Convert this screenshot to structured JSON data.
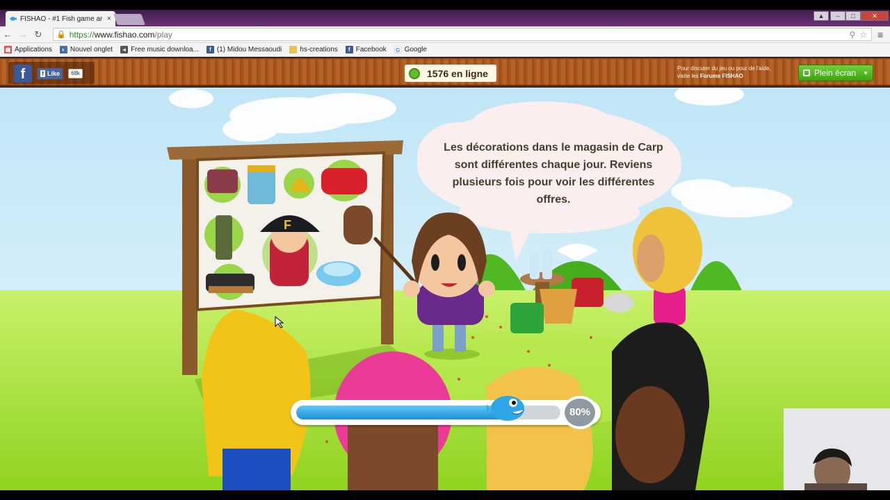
{
  "browser": {
    "tab_title": "FISHAO - #1 Fish game ar",
    "tab_close": "×",
    "url_scheme": "https://",
    "url_host": "www.fishao.com",
    "url_path": "/play",
    "bookmarks": [
      {
        "label": "Applications",
        "icon": "apps-grid-icon",
        "color": "#d9534f"
      },
      {
        "label": "Nouvel onglet",
        "icon": "new-tab-icon",
        "color": "#4a6da7"
      },
      {
        "label": "Free music downloa...",
        "icon": "speaker-icon",
        "color": "#555555"
      },
      {
        "label": "(1) Midou Messaoudi",
        "icon": "facebook-icon",
        "color": "#3b5998"
      },
      {
        "label": "hs-creations",
        "icon": "folder-icon",
        "color": "#e8c25a"
      },
      {
        "label": "Facebook",
        "icon": "facebook-icon",
        "color": "#3b5998"
      },
      {
        "label": "Google",
        "icon": "google-icon",
        "color": "#4285f4"
      }
    ]
  },
  "game_header": {
    "fb_like_label": "Like",
    "fb_like_count": "68k",
    "online_text": "1576 en ligne",
    "forum_line1": "Pour discuter du jeu ou pour de l'aide,",
    "forum_line2_prefix": "visite les ",
    "forum_link": "Forums FISHAO",
    "fullscreen_label": "Plein écran"
  },
  "scene": {
    "speech": "Les décorations dans le magasin de Carp sont différentes chaque jour. Reviens plusieurs fois pour voir les différentes offres.",
    "loading_percent": 80,
    "loading_label": "80%"
  },
  "colors": {
    "accent_green": "#5fbf2a",
    "progress_blue": "#1e8fd6",
    "wood": "#a8581c"
  }
}
